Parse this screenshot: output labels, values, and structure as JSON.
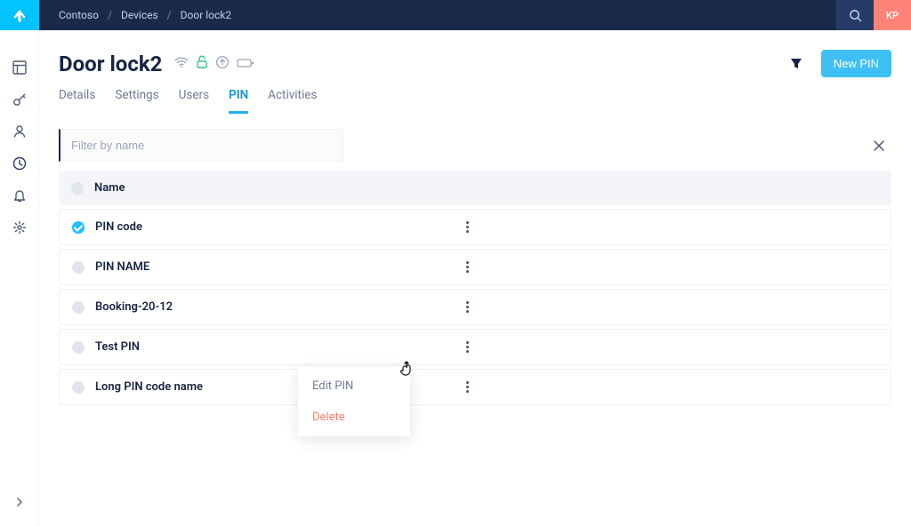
{
  "breadcrumbs": [
    "Contoso",
    "Devices",
    "Door lock2"
  ],
  "avatar": "KP",
  "page": {
    "title": "Door lock2"
  },
  "actions": {
    "new_pin": "New PIN"
  },
  "tabs": [
    {
      "label": "Details",
      "active": false
    },
    {
      "label": "Settings",
      "active": false
    },
    {
      "label": "Users",
      "active": false
    },
    {
      "label": "PIN",
      "active": true
    },
    {
      "label": "Activities",
      "active": false
    }
  ],
  "filter": {
    "placeholder": "Filter by name"
  },
  "table": {
    "header": "Name",
    "rows": [
      {
        "name": "PIN code",
        "selected": true
      },
      {
        "name": "PIN NAME",
        "selected": false
      },
      {
        "name": "Booking-20-12",
        "selected": false
      },
      {
        "name": "Test PIN",
        "selected": false
      },
      {
        "name": "Long PIN code name",
        "selected": false
      }
    ]
  },
  "context_menu": {
    "edit": "Edit PIN",
    "delete": "Delete"
  }
}
